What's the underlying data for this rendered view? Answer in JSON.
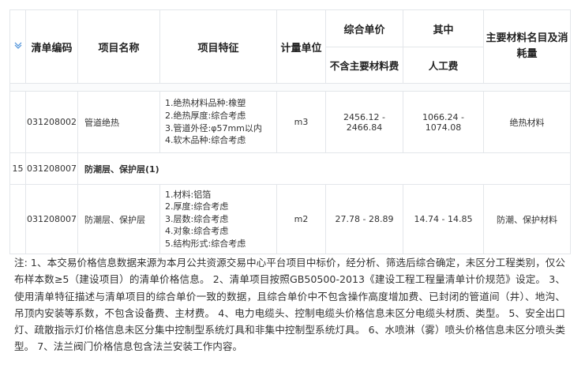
{
  "header": {
    "expand_icon": "chevron-double-down-icon",
    "col_code": "清单编码",
    "col_name": "项目名称",
    "col_feature": "项目特征",
    "col_unit": "计量单位",
    "col_price": "综合单价",
    "col_price_sub": "不含主要材料费",
    "col_of_which": "其中",
    "col_labor": "人工费",
    "col_material": "主要材料名目及消耗量"
  },
  "rows": [
    {
      "code": "031208002",
      "name": "管道绝热",
      "features": [
        "1.绝热材料品种:橡塑",
        "2.绝热厚度:综合考虑",
        "3.管道外径:φ57mm以内",
        "4.软木品种:综合考虑"
      ],
      "unit": "m3",
      "price": "2456.12 - 2466.84",
      "labor": "1066.24 - 1074.08",
      "material": "绝热材料"
    }
  ],
  "group": {
    "index": "15",
    "code": "031208007",
    "name": "防潮层、保护层(1)"
  },
  "group_rows": [
    {
      "code": "031208007",
      "name": "防潮层、保护层",
      "features": [
        "1.材料:铝箔",
        "2.厚度:综合考虑",
        "3.层数:综合考虑",
        "4.对象:综合考虑",
        "5.结构形式:综合考虑"
      ],
      "unit": "m2",
      "price": "27.78 - 28.89",
      "labor": "14.74 - 14.85",
      "material": "防潮、保护材料"
    }
  ],
  "note": "注: 1、本交易价格信息数据来源为本月公共资源交易中心平台项目中标价，经分析、筛选后综合确定，未区分工程类别，仅公布样本数≥5（建设项目）的清单价格信息。 2、清单项目按照GB50500-2013《建设工程工程量清单计价规范》设定。 3、使用清单特征描述与清单项目的综合单价一致的数据，且综合单价中不包含操作高度增加费、已封闭的管道间（井）、地沟、吊顶内安装等系数，不包含设备费、主材费。 4、电力电缆头、控制电缆头价格信息未区分电缆头材质、类型。 5、安全出口灯、疏散指示灯价格信息未区分集中控制型系统灯具和非集中控制型系统灯具。 6、水喷淋（雾）喷头价格信息未区分喷头类型。 7、法兰阀门价格信息包含法兰安装工作内容。"
}
